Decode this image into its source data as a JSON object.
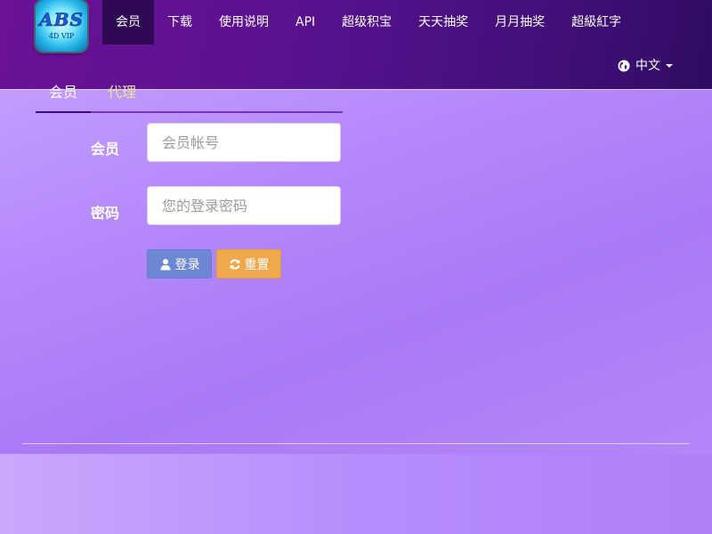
{
  "logo": {
    "main_text": "ABS",
    "sub_text": "4D VIP"
  },
  "nav": {
    "items": [
      {
        "label": "会员",
        "active": true
      },
      {
        "label": "下载",
        "active": false
      },
      {
        "label": "使用说明",
        "active": false
      },
      {
        "label": "API",
        "active": false
      },
      {
        "label": "超级积宝",
        "active": false
      },
      {
        "label": "天天抽奖",
        "active": false
      },
      {
        "label": "月月抽奖",
        "active": false
      },
      {
        "label": "超級紅字",
        "active": false
      }
    ],
    "language": "中文",
    "language_icon": "globe-icon"
  },
  "login": {
    "tabs": [
      {
        "label": "会员",
        "active": true
      },
      {
        "label": "代理",
        "active": false
      }
    ],
    "username_label": "会员",
    "username_placeholder": "会员帐号",
    "password_label": "密码",
    "password_placeholder": "您的登录密码",
    "login_button": "登录",
    "reset_button": "重置"
  },
  "colors": {
    "nav_bg_start": "#6a1298",
    "nav_bg_end": "#2f0c63",
    "nav_active_bg": "#2e0a55",
    "page_bg": "#b489fb",
    "login_button": "#6e87d4",
    "reset_button": "#efa84b",
    "agent_tab_text": "#e8e3a0"
  }
}
